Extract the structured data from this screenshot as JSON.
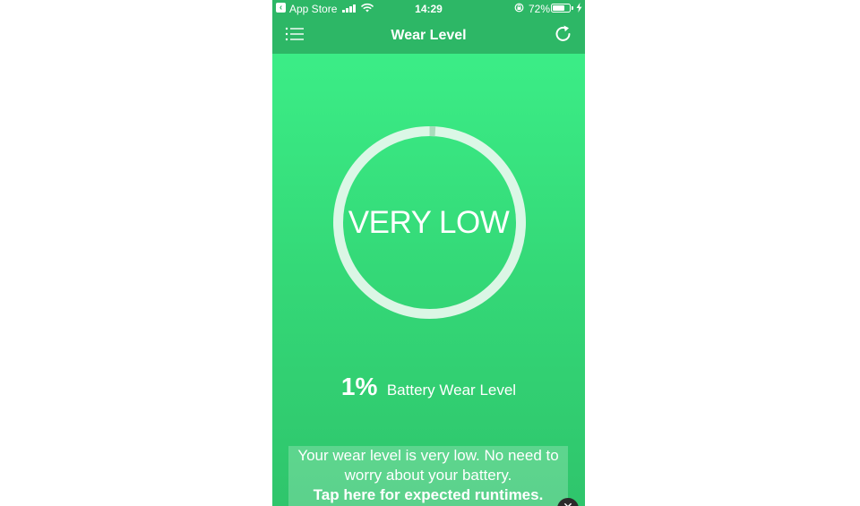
{
  "status_bar": {
    "back_app": "App Store",
    "time": "14:29",
    "battery_percent": "72%",
    "battery_level": 0.72
  },
  "nav": {
    "title": "Wear Level",
    "menu_icon": "list-menu-icon",
    "refresh_icon": "refresh-icon"
  },
  "gauge": {
    "label": "VERY LOW",
    "wear_fraction": 0.01
  },
  "wear": {
    "percent": "1%",
    "label": "Battery Wear Level"
  },
  "info": {
    "line1": "Your wear level is very low. No need to",
    "line2": "worry about your battery.",
    "link": "Tap here for expected runtimes."
  },
  "colors": {
    "bar": "#2db766",
    "background_top": "#3df28a",
    "background_bottom": "#2fc56c"
  }
}
